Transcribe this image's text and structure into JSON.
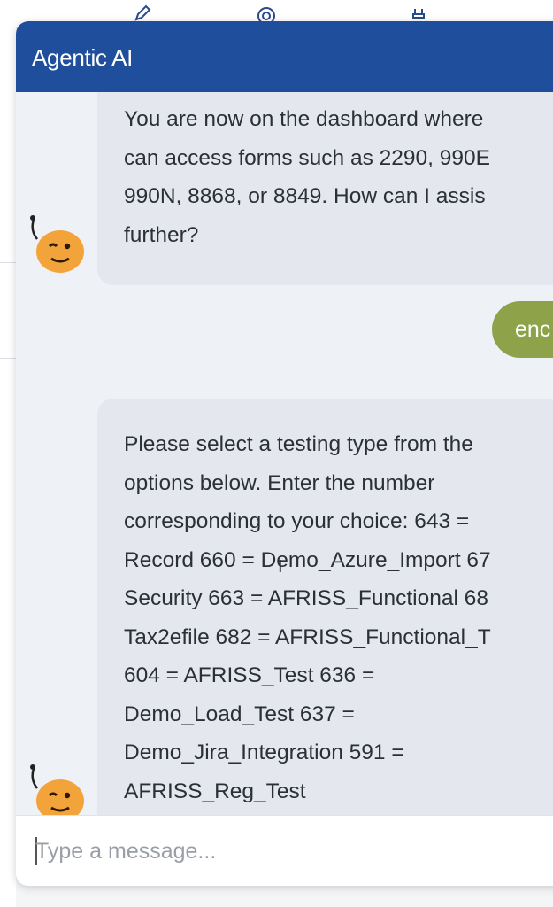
{
  "chat": {
    "title": "Agentic AI",
    "messages": {
      "bot_1": "You are now on the dashboard where\ncan access forms such as 2290, 990E\n990N, 8868, or 8849. How can I assis\nfurther?",
      "user_1": "enc",
      "bot_2": "Please select a testing type from the\noptions below. Enter the number\ncorresponding to your choice: 643 =\nRecord 660 = Demo_Azure_Import 67\nSecurity 663 = AFRISS_Functional 68\nTax2efile 682 = AFRISS_Functional_T\n604 = AFRISS_Test 636 =\nDemo_Load_Test 637 =\nDemo_Jira_Integration 591 =\nAFRISS_Reg_Test"
    },
    "input": {
      "placeholder": "Type a message...",
      "value": ""
    }
  },
  "colors": {
    "header": "#1f4e9c",
    "bot_bubble": "#e4e8ee",
    "user_bubble": "#8ea24a",
    "avatar": "#f2a33a"
  },
  "icons": {
    "topbar": [
      "pen-icon",
      "target-icon",
      "plug-icon"
    ],
    "avatar": "bot-avatar-icon"
  }
}
